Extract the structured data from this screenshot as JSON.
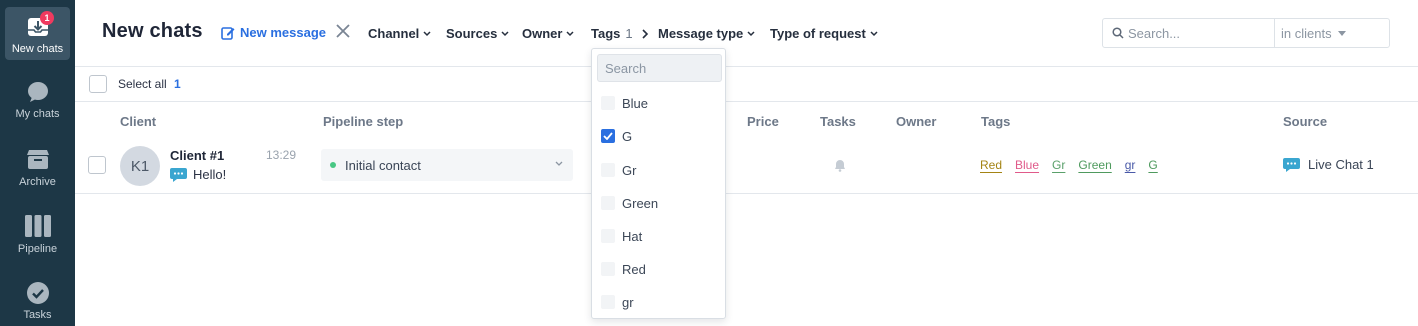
{
  "sidebar": {
    "items": [
      {
        "label": "New chats",
        "icon": "inbox-icon",
        "badge": "1",
        "active": true
      },
      {
        "label": "My chats",
        "icon": "chat-bubble-icon"
      },
      {
        "label": "Archive",
        "icon": "archive-box-icon"
      },
      {
        "label": "Pipeline",
        "icon": "pipeline-columns-icon"
      },
      {
        "label": "Tasks",
        "icon": "check-circle-icon"
      }
    ]
  },
  "header": {
    "title": "New chats",
    "new_message": "New message",
    "filters": {
      "channel": "Channel",
      "sources": "Sources",
      "owner": "Owner",
      "tags": "Tags",
      "tags_count": "1",
      "message_type": "Message type",
      "type_of_request": "Type of request"
    },
    "search": {
      "placeholder": "Search...",
      "scope": "in clients"
    }
  },
  "selection": {
    "label": "Select all",
    "count": "1"
  },
  "table": {
    "columns": {
      "client": "Client",
      "pipeline_step": "Pipeline step",
      "price": "Price",
      "tasks": "Tasks",
      "owner": "Owner",
      "tags": "Tags",
      "source": "Source"
    },
    "rows": [
      {
        "avatar": "K1",
        "client": "Client #1",
        "time": "13:29",
        "message": "Hello!",
        "pipeline_step": "Initial contact",
        "tags": [
          {
            "label": "Red",
            "color": "#a48414"
          },
          {
            "label": "Blue",
            "color": "#e05a8a"
          },
          {
            "label": "Gr",
            "color": "#5aa06a"
          },
          {
            "label": "Green",
            "color": "#4f9a5e"
          },
          {
            "label": "gr",
            "color": "#4a5aa8"
          },
          {
            "label": "G",
            "color": "#4f9a5e"
          }
        ],
        "source": "Live Chat 1"
      }
    ]
  },
  "tags_dropdown": {
    "search_placeholder": "Search",
    "options": [
      {
        "label": "Blue",
        "checked": false
      },
      {
        "label": "G",
        "checked": true
      },
      {
        "label": "Gr",
        "checked": false
      },
      {
        "label": "Green",
        "checked": false
      },
      {
        "label": "Hat",
        "checked": false
      },
      {
        "label": "Red",
        "checked": false
      },
      {
        "label": "gr",
        "checked": false
      }
    ]
  },
  "colors": {
    "accent": "#2a6fe0",
    "sidebar": "#1d3746",
    "badge": "#f03a5f",
    "status_dot": "#48c784"
  }
}
